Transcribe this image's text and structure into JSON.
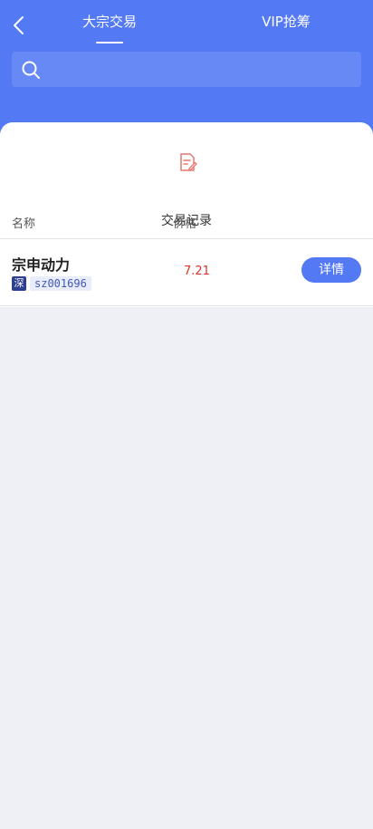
{
  "header": {
    "back_icon": "chevron-left-icon",
    "tabs": [
      {
        "label": "大宗交易",
        "active": true
      },
      {
        "label": "VIP抢筹",
        "active": false
      }
    ],
    "search": {
      "placeholder": "",
      "value": "",
      "icon": "search-icon"
    }
  },
  "records": {
    "label": "交易记录",
    "icon": "edit-document-icon",
    "icon_color": "#e8766e"
  },
  "table": {
    "columns": [
      "名称",
      "价格"
    ],
    "rows": [
      {
        "name": "宗申动力",
        "market": "深",
        "code": "sz001696",
        "price": "7.21",
        "action": "详情"
      }
    ]
  },
  "colors": {
    "accent": "#5379f5",
    "price_up": "#d9342b",
    "market_badge": "#2d3f91",
    "background": "#eff0f5"
  }
}
